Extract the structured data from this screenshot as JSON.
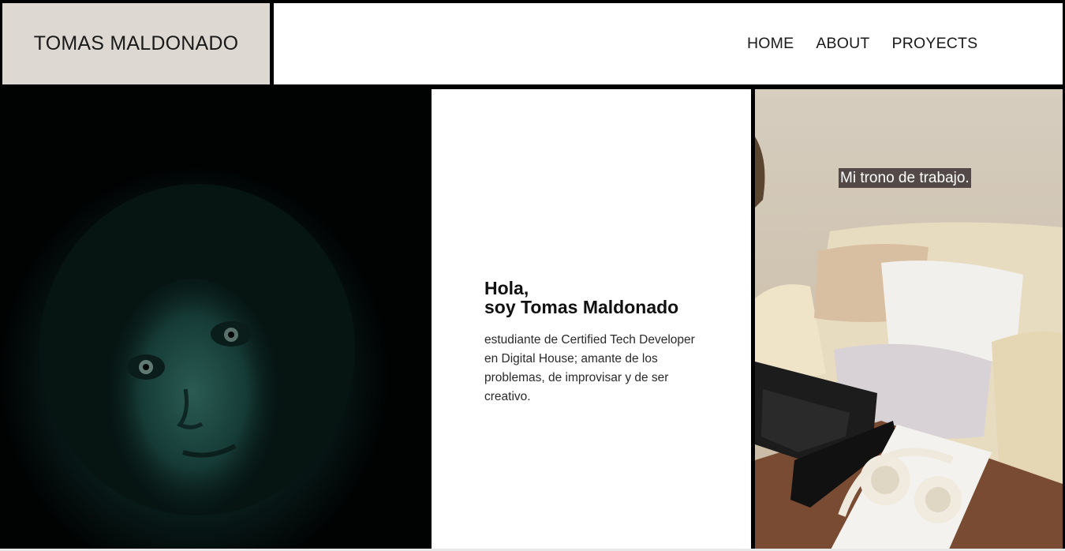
{
  "header": {
    "brand": "TOMAS MALDONADO",
    "nav": [
      "HOME",
      "ABOUT",
      "PROYECTS"
    ]
  },
  "hero": {
    "greeting_line1": "Hola,",
    "greeting_line2": "soy Tomas Maldonado",
    "description": "estudiante de Certified Tech Developer en Digital House; amante de los problemas, de improvisar y de ser creativo."
  },
  "workspace_photo": {
    "caption": "Mi trono de trabajo."
  },
  "colors": {
    "brand_box_bg": "#ded8d2",
    "frame": "#000000",
    "nav_bg": "#ffffff",
    "caption_bg": "#3c3232"
  }
}
